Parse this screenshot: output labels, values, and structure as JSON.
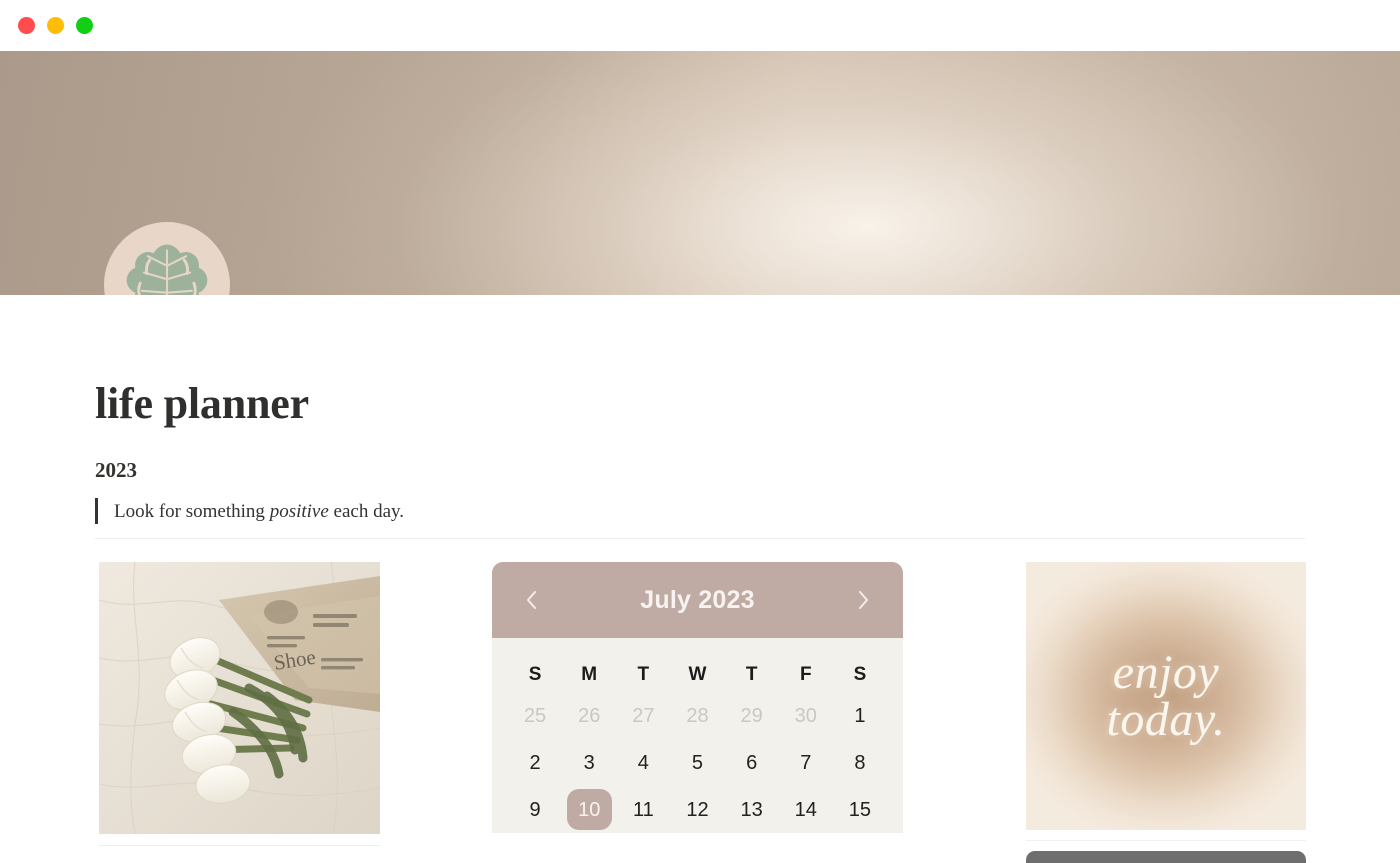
{
  "window": {
    "controls": [
      {
        "name": "close",
        "color": "#ff4d4d"
      },
      {
        "name": "minimize",
        "color": "#ffbd08"
      },
      {
        "name": "maximize",
        "color": "#13cf13"
      }
    ]
  },
  "banner": {
    "gradient_from": "#ab9a8b",
    "gradient_to": "#b9a897",
    "highlight": "#fffaf3"
  },
  "avatar": {
    "icon": "monstera-leaf-icon",
    "circle_color": "#e8d6c9",
    "leaf_color": "#9cb29a"
  },
  "page": {
    "title": "life planner",
    "year": "2023",
    "quote_prefix": "Look for something ",
    "quote_emphasis": "positive",
    "quote_suffix": " each day."
  },
  "photo": {
    "alt": "white tulips wrapped in newspaper on linen",
    "linen_color": "#e6e0d5",
    "paper_color": "#cbbba4",
    "stem_color": "#6f7d4e",
    "bloom_color": "#f7f4ea"
  },
  "calendar": {
    "title": "July 2023",
    "prev_icon": "chevron-left-icon",
    "next_icon": "chevron-right-icon",
    "header_color": "#bfaba4",
    "body_color": "#f2f1ec",
    "today": 10,
    "weekdays": [
      "S",
      "M",
      "T",
      "W",
      "T",
      "F",
      "S"
    ],
    "weeks": [
      [
        {
          "day": "25",
          "muted": true
        },
        {
          "day": "26",
          "muted": true
        },
        {
          "day": "27",
          "muted": true
        },
        {
          "day": "28",
          "muted": true
        },
        {
          "day": "29",
          "muted": true
        },
        {
          "day": "30",
          "muted": true
        },
        {
          "day": "1",
          "muted": false
        }
      ],
      [
        {
          "day": "2",
          "muted": false
        },
        {
          "day": "3",
          "muted": false
        },
        {
          "day": "4",
          "muted": false
        },
        {
          "day": "5",
          "muted": false
        },
        {
          "day": "6",
          "muted": false
        },
        {
          "day": "7",
          "muted": false
        },
        {
          "day": "8",
          "muted": false
        }
      ],
      [
        {
          "day": "9",
          "muted": false
        },
        {
          "day": "10",
          "muted": false,
          "today": true
        },
        {
          "day": "11",
          "muted": false
        },
        {
          "day": "12",
          "muted": false
        },
        {
          "day": "13",
          "muted": false
        },
        {
          "day": "14",
          "muted": false
        },
        {
          "day": "15",
          "muted": false
        }
      ]
    ]
  },
  "quote_card": {
    "line1": "enjoy",
    "line2": "today.",
    "glow_center": "#c3a183",
    "glow_edge": "#f4ebdf",
    "text_color": "#fbf6ee"
  }
}
